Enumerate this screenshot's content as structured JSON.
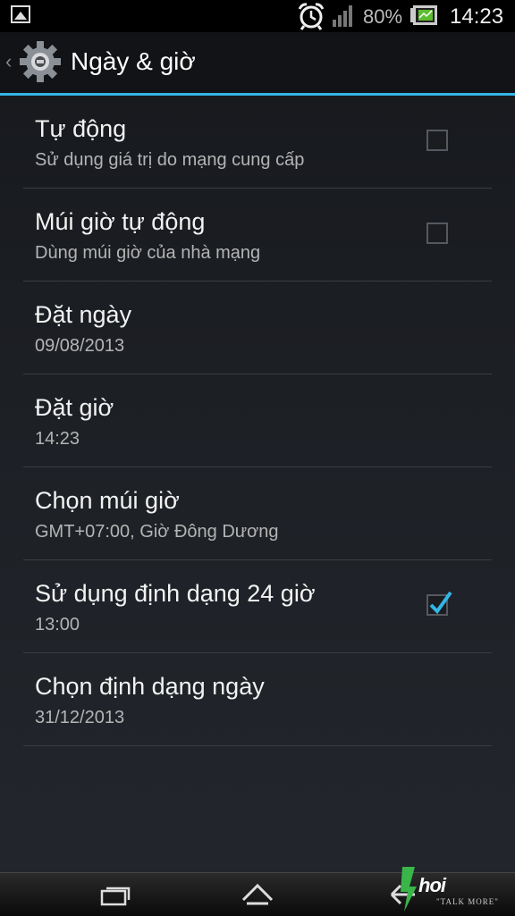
{
  "status_bar": {
    "battery_percent": "80%",
    "time": "14:23",
    "icons": [
      "gallery-icon",
      "alarm-clock-icon",
      "signal-icon",
      "battery-icon"
    ]
  },
  "action_bar": {
    "title": "Ngày & giờ",
    "up_caret": "‹",
    "icon": "settings-gear-icon"
  },
  "settings": [
    {
      "label": "Tự động",
      "summary": "Sử dụng giá trị do mạng cung cấp",
      "has_checkbox": true,
      "checked": false
    },
    {
      "label": "Múi giờ tự động",
      "summary": "Dùng múi giờ của nhà mạng",
      "has_checkbox": true,
      "checked": false
    },
    {
      "label": "Đặt ngày",
      "summary": "09/08/2013",
      "has_checkbox": false
    },
    {
      "label": "Đặt giờ",
      "summary": "14:23",
      "has_checkbox": false
    },
    {
      "label": "Chọn múi giờ",
      "summary": "GMT+07:00, Giờ Đông Dương",
      "has_checkbox": false
    },
    {
      "label": "Sử dụng định dạng 24 giờ",
      "summary": "13:00",
      "has_checkbox": true,
      "checked": true
    },
    {
      "label": "Chọn định dạng ngày",
      "summary": "31/12/2013",
      "has_checkbox": false
    }
  ],
  "nav_bar": {
    "icons": [
      "recent-apps-icon",
      "home-icon",
      "back-icon"
    ]
  },
  "watermark": {
    "text": "hoi",
    "tagline": "\"TALK MORE\""
  },
  "colors": {
    "accent": "#33b5e5",
    "background": "#1c1f24",
    "divider": "#3a3d42"
  }
}
